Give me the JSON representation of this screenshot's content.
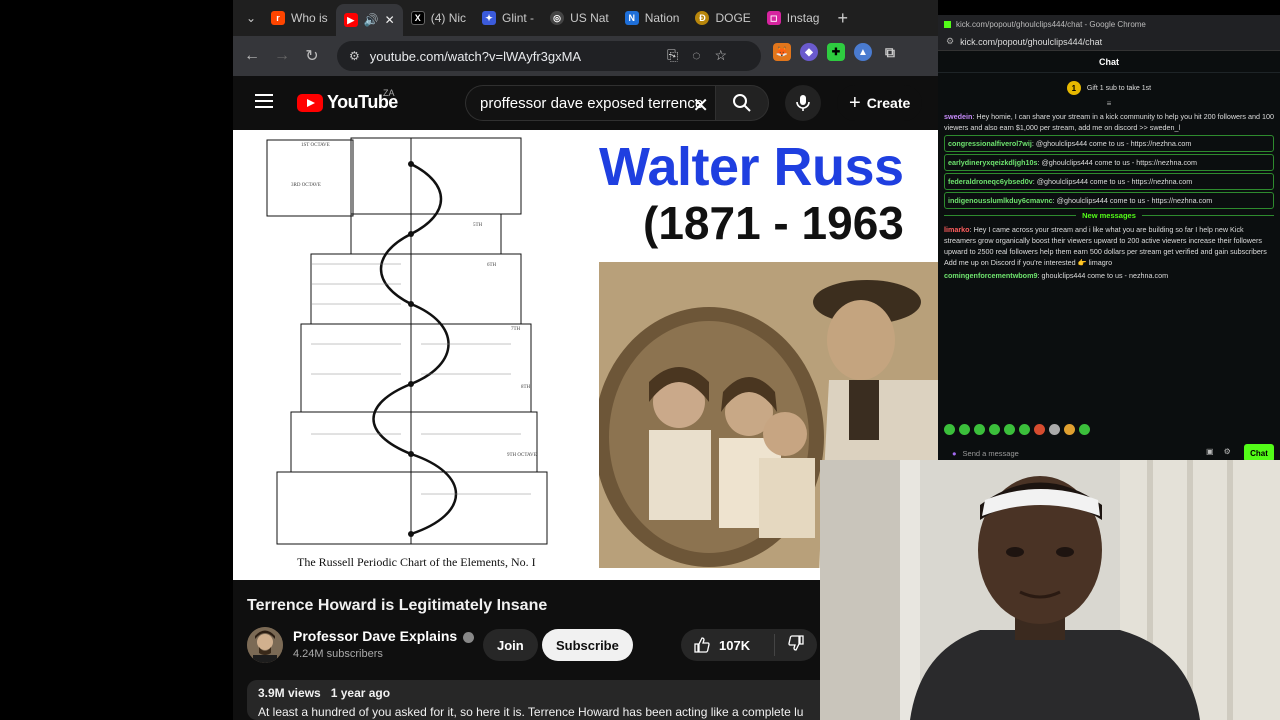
{
  "browser": {
    "tabs": [
      {
        "label": "Who is",
        "favicon": "reddit-icon",
        "color": "#ff4500"
      },
      {
        "label": "",
        "favicon": "youtube-icon",
        "color": "#ff0000",
        "active": true
      },
      {
        "label": "(4) Nic",
        "favicon": "x-icon",
        "color": "#000000"
      },
      {
        "label": "Glint -",
        "favicon": "glint-icon",
        "color": "#3b5bdb"
      },
      {
        "label": "US Nat",
        "favicon": "globe-icon",
        "color": "#444444"
      },
      {
        "label": "Nation",
        "favicon": "nation-icon",
        "color": "#1e6fd9"
      },
      {
        "label": "DOGE",
        "favicon": "doge-icon",
        "color": "#b8860b"
      },
      {
        "label": "Instag",
        "favicon": "instagram-icon",
        "color": "#d6249f"
      }
    ],
    "url": "youtube.com/watch?v=lWAyfr3gxMA"
  },
  "youtube": {
    "logo_text": "YouTube",
    "country_code": "ZA",
    "search_value": "proffessor dave exposed terrence",
    "create_label": "Create",
    "video": {
      "chart_caption": "The Russell Periodic Chart of the Elements, No. I",
      "slide_title": "Walter Russ",
      "slide_years": "(1871 - 1963"
    },
    "title": "Terrence Howard is Legitimately Insane",
    "channel": "Professor Dave Explains",
    "subscribers": "4.24M subscribers",
    "join_label": "Join",
    "subscribe_label": "Subscribe",
    "likes": "107K",
    "views": "3.9M views",
    "age": "1 year ago",
    "description": "At least a hundred of you asked for it, so here it is. Terrence Howard has been acting like a complete lu"
  },
  "kick": {
    "window_title": "kick.com/popout/ghoulclips444/chat - Google Chrome",
    "url": "kick.com/popout/ghoulclips444/chat",
    "header": "Chat",
    "gift_text": "Gift 1 sub to take 1st",
    "messages": [
      {
        "user": "swedein",
        "color": "#c58af9",
        "text": "Hey homie, I can share your stream in a kick community to help you hit 200 followers and 100 viewers and also earn $1,000 per stream, add me on discord >> sweden_l",
        "highlight": false
      },
      {
        "user": "congressionalfiverol7wij",
        "color": "#6ee36e",
        "text": "@ghoulclips444 come to us - https://nezhna.com",
        "highlight": true
      },
      {
        "user": "earlydineryxqeizkdljgh10s",
        "color": "#6ee36e",
        "text": "@ghoulclips444 come to us - https://nezhna.com",
        "highlight": true
      },
      {
        "user": "federaldroneqc6ybsed0v",
        "color": "#6ee36e",
        "text": "@ghoulclips444 come to us - https://nezhna.com",
        "highlight": true
      },
      {
        "user": "indigenousslumlkduy6cmavnc",
        "color": "#6ee36e",
        "text": "@ghoulclips444 come to us - https://nezhna.com",
        "highlight": true
      }
    ],
    "new_messages_label": "New messages",
    "new_messages": [
      {
        "user": "limarko",
        "color": "#ff5c5c",
        "text": "Hey I came across your stream and i like what you are building so far I help new Kick streamers grow organically boost their viewers upward to 200 active viewers increase their followers upward to 2500 real followers help them earn 500 dollars per stream get verified and gain subscribers Add me up on Discord if you're interested 👉 limagro"
      },
      {
        "user": "comingenforcementwbom9",
        "color": "#6ee36e",
        "text": "ghoulclips444 come to us - nezhna.com"
      }
    ],
    "send_placeholder": "Send a message",
    "chat_button": "Chat",
    "accent": "#53fc18"
  }
}
